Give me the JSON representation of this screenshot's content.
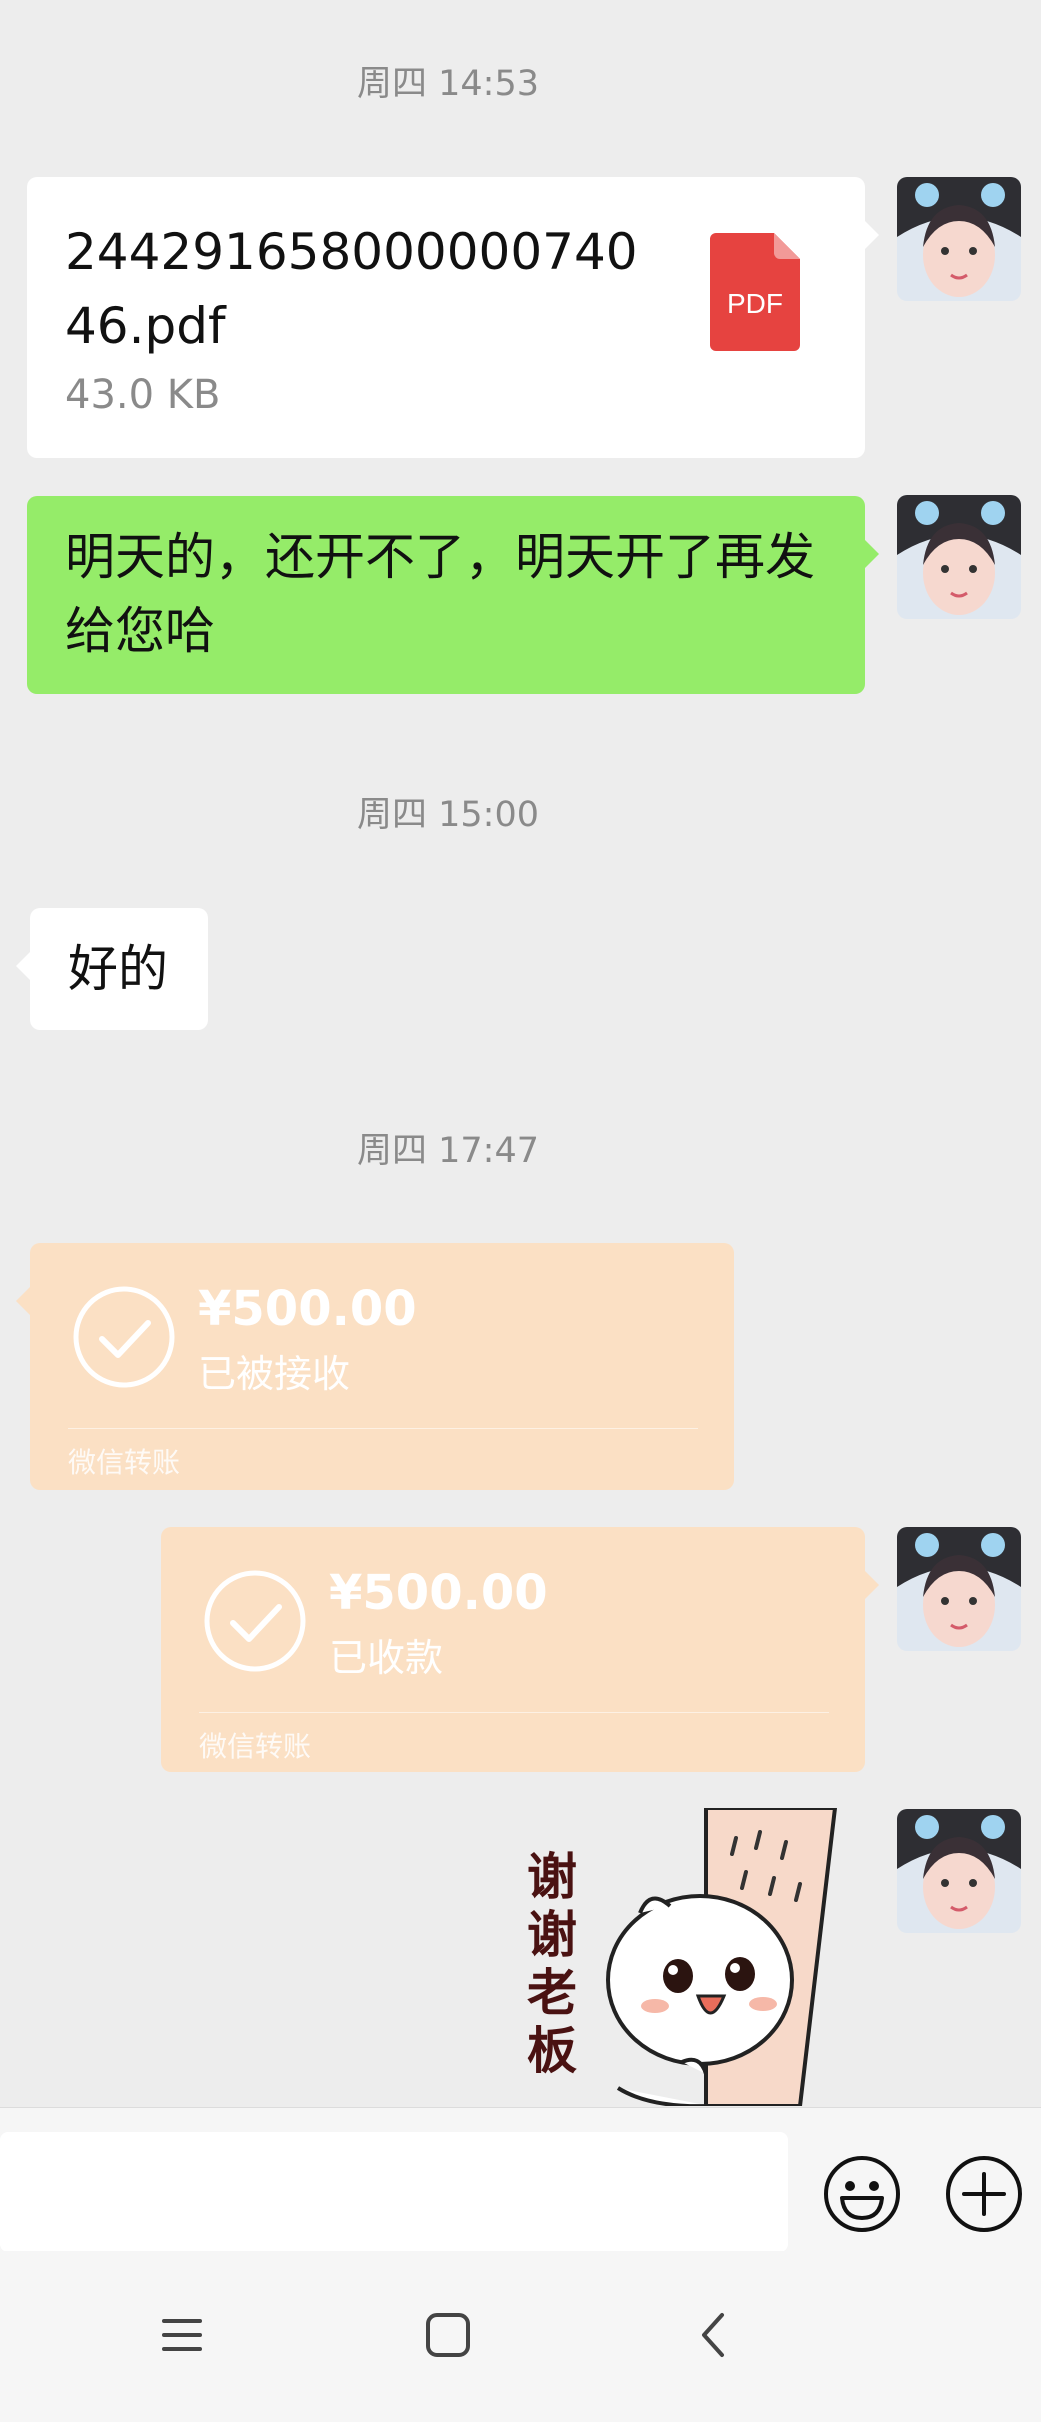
{
  "timestamps": [
    "周四 14:53",
    "周四 15:00",
    "周四 17:47"
  ],
  "messages": {
    "file": {
      "name": "24429165800000074046.pdf",
      "size": "43.0 KB",
      "type_label": "PDF"
    },
    "green_text": "明天的，还开不了，明天开了再发给您哈",
    "reply_text": "好的",
    "transfer_received": {
      "amount": "¥500.00",
      "status": "已被接收",
      "footer": "微信转账"
    },
    "transfer_collected": {
      "amount": "¥500.00",
      "status": "已收款",
      "footer": "微信转账"
    },
    "sticker_text": "谢谢老板"
  },
  "input": {
    "placeholder": ""
  },
  "icons": [
    "pdf-icon",
    "check-circle-icon",
    "emoji-icon",
    "plus-icon",
    "menu-icon",
    "home-icon",
    "back-icon"
  ],
  "colors": {
    "background": "#ededed",
    "green_bubble": "#95ec69",
    "transfer": "#fbe0c4",
    "pdf_red": "#e64340"
  }
}
